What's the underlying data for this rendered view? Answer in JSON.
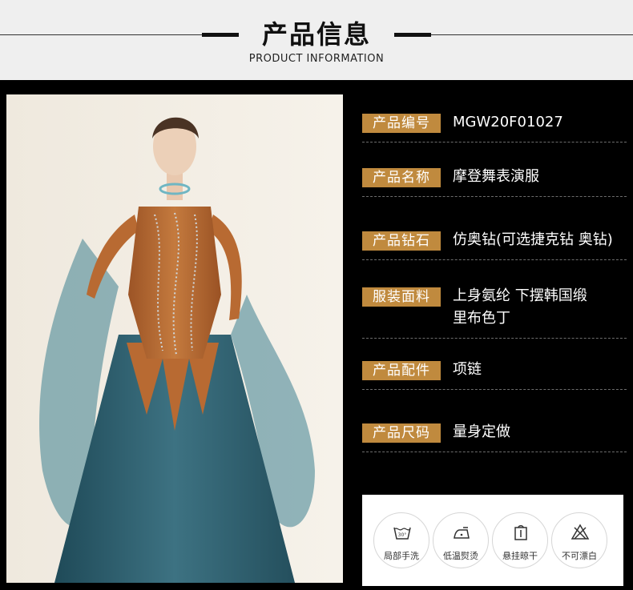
{
  "header": {
    "title": "产品信息",
    "subtitle": "PRODUCT INFORMATION"
  },
  "info": [
    {
      "label": "产品编号",
      "value": "MGW20F01027"
    },
    {
      "label": "产品名称",
      "value": "摩登舞表演服"
    },
    {
      "label": "产品钻石",
      "value": "仿奥钻(可选捷克钻 奥钻)"
    },
    {
      "label": "服装面料",
      "value": "上身氨纶 下摆韩国缎\n里布色丁"
    },
    {
      "label": "产品配件",
      "value": "项链"
    },
    {
      "label": "产品尺码",
      "value": "量身定做"
    }
  ],
  "care": [
    {
      "icon": "hand-wash-icon",
      "label": "局部手洗"
    },
    {
      "icon": "low-iron-icon",
      "label": "低温熨烫"
    },
    {
      "icon": "hang-dry-icon",
      "label": "悬挂晾干"
    },
    {
      "icon": "no-bleach-icon",
      "label": "不可漂白"
    }
  ],
  "colors": {
    "accent": "#c08a3e",
    "dress_top": "#b86a32",
    "dress_skirt": "#2f5f6e",
    "background": "#000000"
  }
}
